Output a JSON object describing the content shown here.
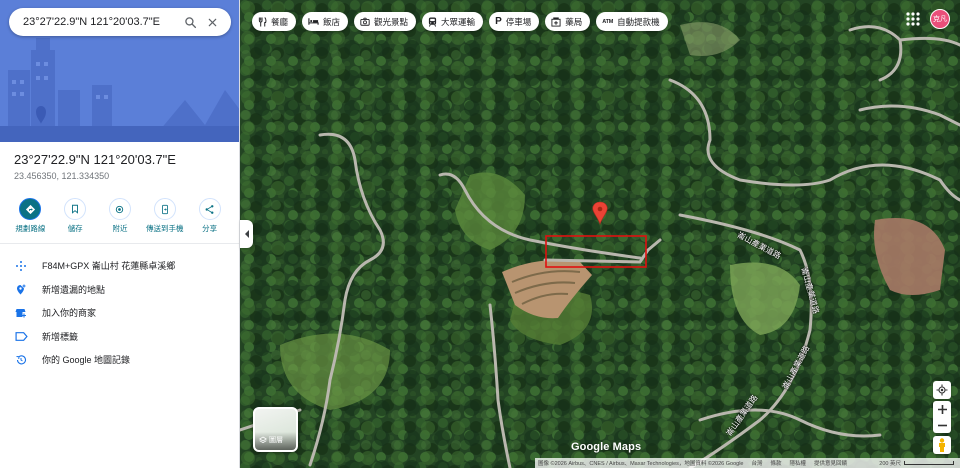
{
  "search": {
    "value": "23°27'22.9\"N 121°20'03.7\"E"
  },
  "place": {
    "title": "23°27'22.9\"N 121°20'03.7\"E",
    "decimal": "23.456350, 121.334350"
  },
  "actions": [
    {
      "label": "規劃路線",
      "icon": "directions-icon"
    },
    {
      "label": "儲存",
      "icon": "bookmark-icon"
    },
    {
      "label": "附近",
      "icon": "nearby-icon"
    },
    {
      "label": "傳送到手機",
      "icon": "send-to-phone-icon"
    },
    {
      "label": "分享",
      "icon": "share-icon"
    }
  ],
  "details": [
    {
      "text": "F84M+GPX 崙山村 花蓮縣卓溪鄉",
      "icon": "plus-code-icon"
    },
    {
      "text": "新增遺漏的地點",
      "icon": "add-place-icon"
    },
    {
      "text": "加入你的商家",
      "icon": "store-icon"
    },
    {
      "text": "新增標籤",
      "icon": "label-icon"
    },
    {
      "text": "你的 Google 地圖記錄",
      "icon": "history-icon"
    }
  ],
  "chips": [
    {
      "label": "餐廳",
      "icon": "restaurant-icon"
    },
    {
      "label": "飯店",
      "icon": "hotel-icon"
    },
    {
      "label": "觀光景點",
      "icon": "camera-icon"
    },
    {
      "label": "大眾運輸",
      "icon": "transit-icon"
    },
    {
      "label": "停車場",
      "icon": "parking-icon"
    },
    {
      "label": "藥局",
      "icon": "pharmacy-icon"
    },
    {
      "label": "自動提款機",
      "icon": "atm-icon"
    }
  ],
  "avatar": {
    "text": "克凡"
  },
  "layers": {
    "label": "圖層"
  },
  "map": {
    "road_labels": [
      "崙山產業道路",
      "崙山產業道路",
      "崙山產業道路",
      "崙山產業道路"
    ],
    "logo": "Google Maps",
    "attribution": [
      "圖像 ©2026 Airbus、CNES / Airbus、Maxar Technologies，地圖資料 ©2026 Google",
      "台灣",
      "條款",
      "隱私權",
      "提供意見回饋"
    ],
    "scale": "200 英尺"
  },
  "colors": {
    "accent": "#0b7285",
    "marker": "#ea4335",
    "highlight_box": "#e01010",
    "hero": "#5b7fd8"
  }
}
